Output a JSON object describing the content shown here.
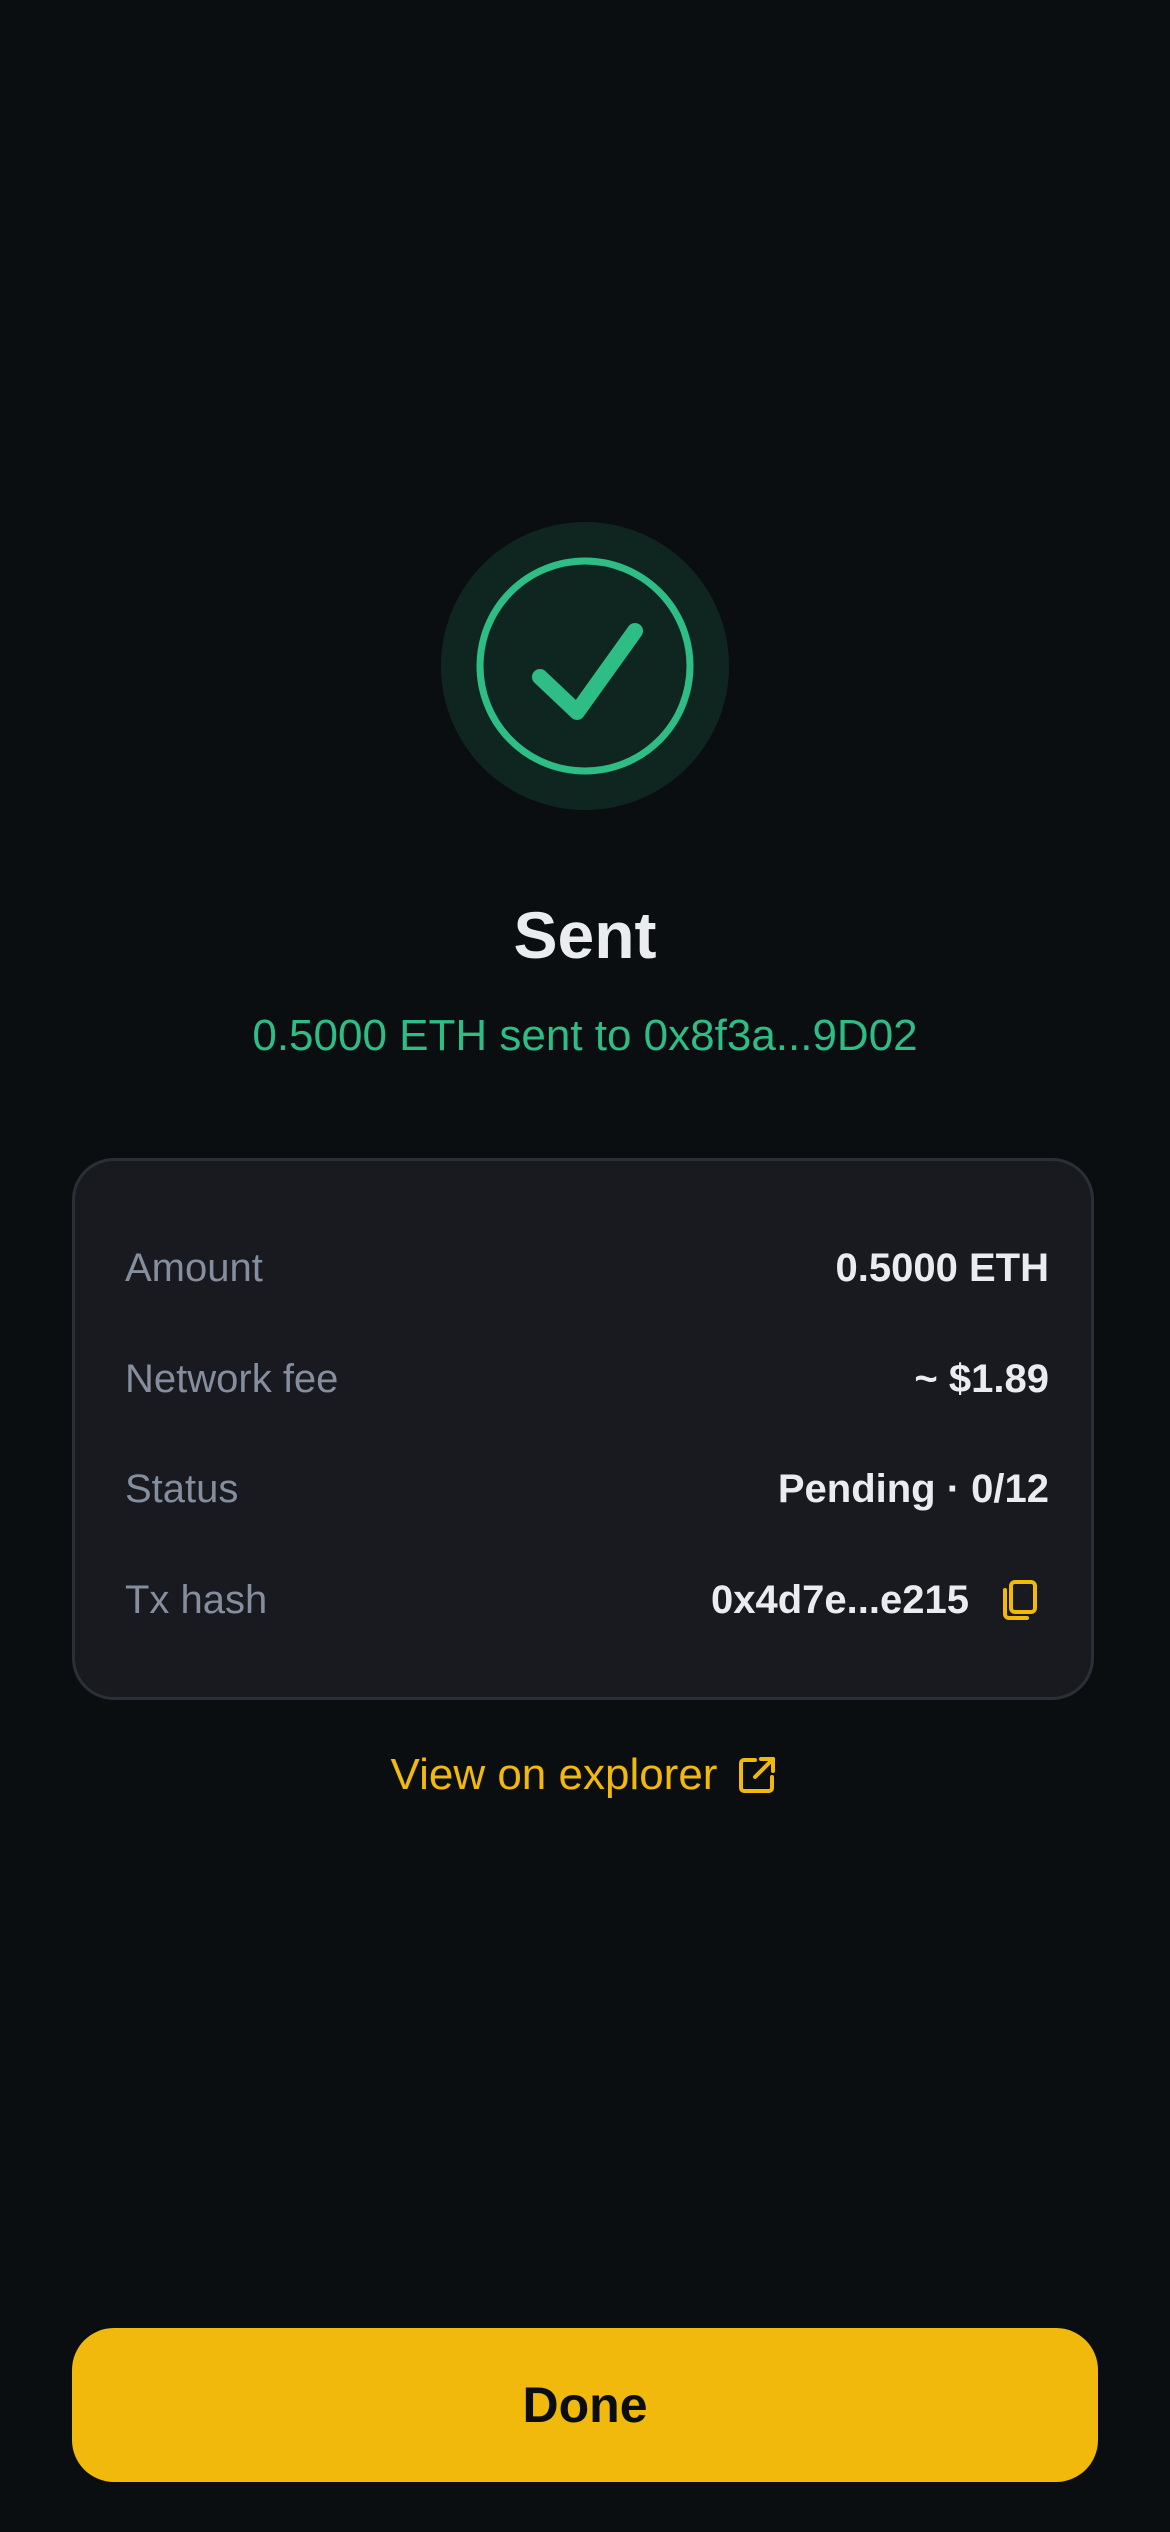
{
  "result": {
    "title": "Sent",
    "subtitle": "0.5000 ETH sent to 0x8f3a...9D02",
    "icon": "check-circle-icon"
  },
  "details": {
    "rows": [
      {
        "label": "Amount",
        "value": "0.5000 ETH"
      },
      {
        "label": "Network fee",
        "value": "~ $1.89"
      },
      {
        "label": "Status",
        "value": "Pending · 0/12"
      },
      {
        "label": "Tx hash",
        "value": "0x4d7e...e215",
        "icon": "copy-icon"
      }
    ]
  },
  "explorer": {
    "label": "View on explorer",
    "icon": "external-link-icon"
  },
  "actions": {
    "done_label": "Done"
  },
  "colors": {
    "background": "#0b0e11",
    "card": "#181a20",
    "success": "#2ebd85",
    "accent": "#f0b90b",
    "muted": "#848e9c",
    "text": "#eaecef"
  }
}
